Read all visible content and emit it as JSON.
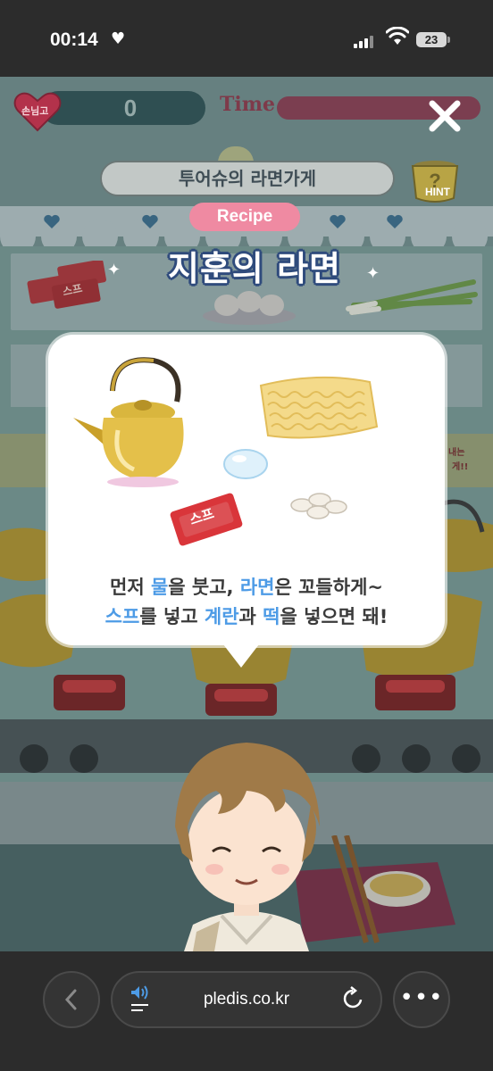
{
  "status_bar": {
    "time": "00:14",
    "heart_glyph": "♥",
    "battery": "23"
  },
  "hud": {
    "heart_label": "손님고",
    "score": "0",
    "time_label": "Time",
    "hint_label": "HINT"
  },
  "sign": {
    "text": "투어슈의 라면가게"
  },
  "recipe": {
    "badge": "Recipe",
    "title": "지훈의 라면",
    "soup_packet_label": "스프",
    "instruction_line1": {
      "p1": "먼저 ",
      "h1": "물",
      "p2": "을 붓고, ",
      "h2": "라면",
      "p3": "은 꼬들하게~"
    },
    "instruction_line2": {
      "h1": "스프",
      "p1": "를 넣고 ",
      "h2": "계란",
      "p2": "과 ",
      "h3": "떡",
      "p3": "을 넣으면 돼!"
    }
  },
  "background_labels": {
    "shelf_packets": "스프",
    "side_note_1": "내는",
    "side_note_2": "게!!"
  },
  "browser": {
    "url": "pledis.co.kr",
    "more_glyph": "•••"
  },
  "colors": {
    "highlight": "#4d9be6",
    "recipe_badge": "#ef8aa2",
    "title_outline": "#2f4b7c"
  }
}
